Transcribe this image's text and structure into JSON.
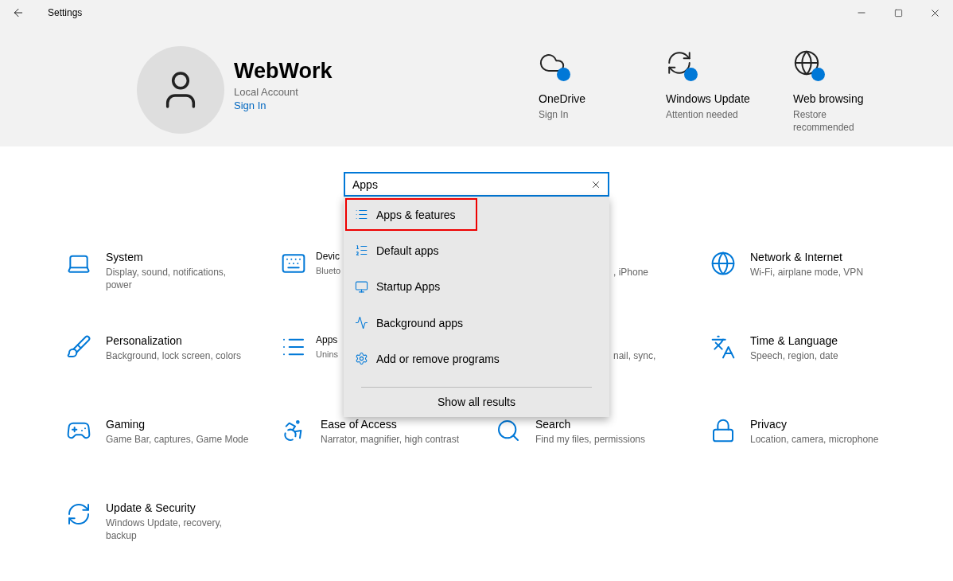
{
  "window": {
    "title": "Settings"
  },
  "account": {
    "name": "WebWork",
    "type": "Local Account",
    "link": "Sign In"
  },
  "status_items": [
    {
      "title": "OneDrive",
      "subtitle": "Sign In"
    },
    {
      "title": "Windows Update",
      "subtitle": "Attention needed"
    },
    {
      "title": "Web browsing",
      "subtitle": "Restore recommended"
    }
  ],
  "search": {
    "value": "Apps"
  },
  "suggestions": [
    {
      "label": "Apps & features",
      "selected": true
    },
    {
      "label": "Default apps",
      "selected": false
    },
    {
      "label": "Startup Apps",
      "selected": false
    },
    {
      "label": "Background apps",
      "selected": false
    },
    {
      "label": "Add or remove programs",
      "selected": false
    }
  ],
  "show_all": "Show all results",
  "tiles": [
    {
      "kind": "full",
      "title": "System",
      "subtitle": "Display, sound, notifications, power"
    },
    {
      "kind": "cut-right",
      "title": "Devic",
      "subtitle": "Blueto"
    },
    {
      "kind": "cut-left",
      "subtitle": ", iPhone"
    },
    {
      "kind": "full",
      "title": "Network & Internet",
      "subtitle": "Wi-Fi, airplane mode, VPN"
    },
    {
      "kind": "full",
      "title": "Personalization",
      "subtitle": "Background, lock screen, colors"
    },
    {
      "kind": "cut-right",
      "title": "Apps",
      "subtitle": "Unins"
    },
    {
      "kind": "cut-left",
      "subtitle": "nail, sync,"
    },
    {
      "kind": "full",
      "title": "Time & Language",
      "subtitle": "Speech, region, date"
    },
    {
      "kind": "full",
      "title": "Gaming",
      "subtitle": "Game Bar, captures, Game Mode"
    },
    {
      "kind": "full",
      "title": "Ease of Access",
      "subtitle": "Narrator, magnifier, high contrast"
    },
    {
      "kind": "full",
      "title": "Search",
      "subtitle": "Find my files, permissions"
    },
    {
      "kind": "full",
      "title": "Privacy",
      "subtitle": "Location, camera, microphone"
    },
    {
      "kind": "full",
      "title": "Update & Security",
      "subtitle": "Windows Update, recovery, backup"
    }
  ]
}
